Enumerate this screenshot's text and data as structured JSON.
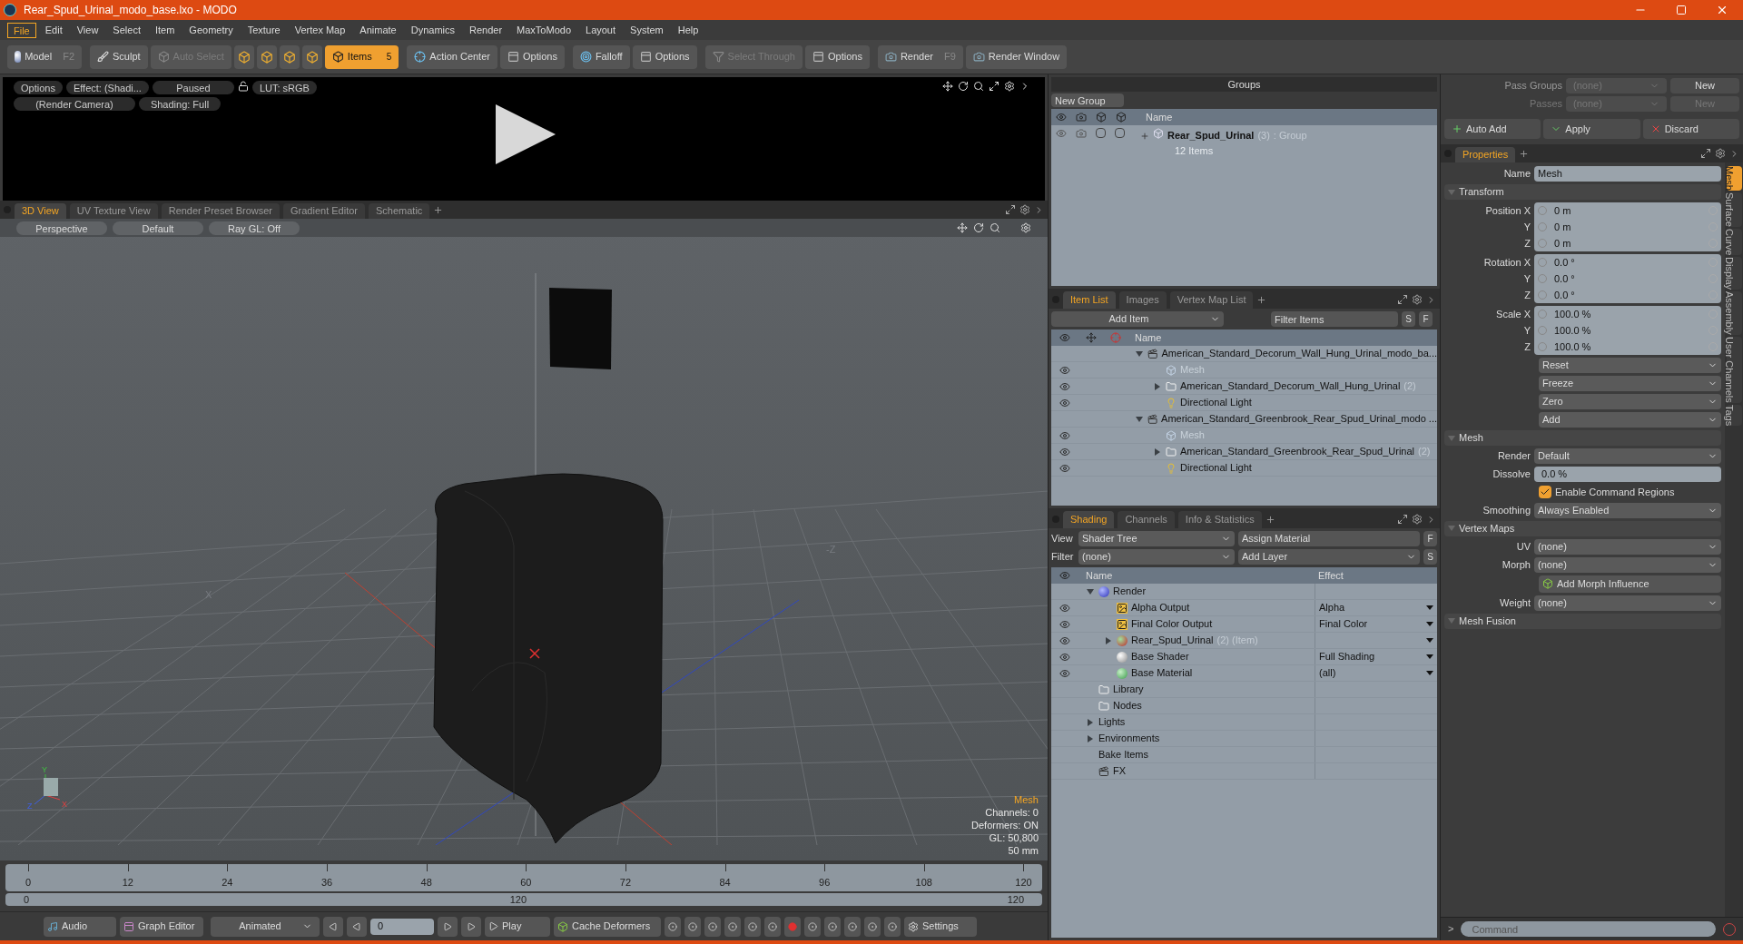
{
  "window": {
    "title": "Rear_Spud_Urinal_modo_base.lxo - MODO"
  },
  "menu": [
    {
      "label": "File",
      "selected": true
    },
    {
      "label": "Edit",
      "selected": false
    },
    {
      "label": "View",
      "selected": false
    },
    {
      "label": "Select",
      "selected": false
    },
    {
      "label": "Item",
      "selected": false
    },
    {
      "label": "Geometry",
      "selected": false
    },
    {
      "label": "Texture",
      "selected": false
    },
    {
      "label": "Vertex Map",
      "selected": false
    },
    {
      "label": "Animate",
      "selected": false
    },
    {
      "label": "Dynamics",
      "selected": false
    },
    {
      "label": "Render",
      "selected": false
    },
    {
      "label": "MaxToModo",
      "selected": false
    },
    {
      "label": "Layout",
      "selected": false
    },
    {
      "label": "System",
      "selected": false
    },
    {
      "label": "Help",
      "selected": false
    }
  ],
  "toolbar": [
    {
      "label": "Model",
      "shortcut": "F2",
      "selected": false,
      "disabled": false
    },
    {
      "label": "Sculpt",
      "selected": false,
      "disabled": false
    },
    {
      "label": "Auto Select",
      "selected": false,
      "disabled": true
    },
    {
      "label": "Items",
      "badge": "5",
      "selected": true,
      "disabled": false
    },
    {
      "label": "Action Center",
      "selected": false,
      "disabled": false
    },
    {
      "label": "Options",
      "selected": false,
      "disabled": false
    },
    {
      "label": "Falloff",
      "selected": false,
      "disabled": false
    },
    {
      "label": "Options",
      "selected": false,
      "disabled": false
    },
    {
      "label": "Select Through",
      "selected": false,
      "disabled": true
    },
    {
      "label": "Options",
      "selected": false,
      "disabled": false
    },
    {
      "label": "Render",
      "shortcut": "F9",
      "selected": false,
      "disabled": false
    },
    {
      "label": "Render Window",
      "selected": false,
      "disabled": false
    }
  ],
  "preview": {
    "row1": [
      "Options",
      "Effect: (Shadi...",
      "Paused",
      "LUT: sRGB"
    ],
    "row2": [
      "(Render Camera)",
      "Shading: Full"
    ]
  },
  "viewport_tabs": [
    {
      "label": "3D View",
      "selected": true
    },
    {
      "label": "UV Texture View",
      "selected": false
    },
    {
      "label": "Render Preset Browser",
      "selected": false
    },
    {
      "label": "Gradient Editor",
      "selected": false
    },
    {
      "label": "Schematic",
      "selected": false
    }
  ],
  "viewport": {
    "buttons": [
      "Perspective",
      "Default",
      "Ray GL: Off"
    ],
    "axis_labels": [
      "-Z",
      "X"
    ],
    "gizmo_labels": [
      "Y",
      "Z",
      "X"
    ],
    "info_title": "Mesh",
    "info": [
      "Channels: 0",
      "Deformers: ON",
      "GL: 50,800",
      "50 mm"
    ]
  },
  "timeline": {
    "ticks": [
      "0",
      "12",
      "24",
      "36",
      "48",
      "60",
      "72",
      "84",
      "96",
      "108",
      "120"
    ],
    "range_start": "0",
    "range_mid": "120",
    "range_end": "120"
  },
  "transport": {
    "audio": "Audio",
    "graph_editor": "Graph Editor",
    "mode": "Animated",
    "frame": "0",
    "play": "Play",
    "cache": "Cache Deformers",
    "settings": "Settings"
  },
  "groups": {
    "title": "Groups",
    "new_group": "New Group",
    "column": "Name",
    "rows": [
      {
        "name": "Rear_Spud_Urinal",
        "count": "(3)",
        "type": ": Group",
        "items": "12 Items",
        "flags": [
          {
            "checked": false
          },
          {
            "checked": false
          }
        ]
      }
    ]
  },
  "item_list": {
    "tabs": [
      {
        "label": "Item List",
        "selected": true
      },
      {
        "label": "Images",
        "selected": false
      },
      {
        "label": "Vertex Map List",
        "selected": false
      }
    ],
    "add_item": "Add Item",
    "filter_placeholder": "Filter Items",
    "s": "S",
    "f": "F",
    "column": "Name",
    "items": [
      {
        "name": "American_Standard_Decorum_Wall_Hung_Urinal_modo_ba...",
        "kind": "scene",
        "expanded": true,
        "visible": false,
        "children": [
          {
            "name": "Mesh",
            "kind": "mesh",
            "visible": true
          },
          {
            "name": "American_Standard_Decorum_Wall_Hung_Urinal",
            "count": "(2)",
            "kind": "group",
            "expanded": false,
            "visible": true
          },
          {
            "name": "Directional Light",
            "kind": "light",
            "visible": true
          }
        ]
      },
      {
        "name": "American_Standard_Greenbrook_Rear_Spud_Urinal_modo ...",
        "kind": "scene",
        "expanded": true,
        "visible": false,
        "children": [
          {
            "name": "Mesh",
            "kind": "mesh",
            "visible": true
          },
          {
            "name": "American_Standard_Greenbrook_Rear_Spud_Urinal",
            "count": "(2)",
            "kind": "group",
            "expanded": false,
            "visible": true
          },
          {
            "name": "Directional Light",
            "kind": "light",
            "visible": true
          }
        ]
      }
    ]
  },
  "shading": {
    "tabs": [
      {
        "label": "Shading",
        "selected": true
      },
      {
        "label": "Channels",
        "selected": false
      },
      {
        "label": "Info & Statistics",
        "selected": false
      }
    ],
    "view_label": "View",
    "view": "Shader Tree",
    "assign": "Assign Material",
    "f": "F",
    "filter_label": "Filter",
    "filter": "(none)",
    "add_layer": "Add Layer",
    "s": "S",
    "columns": [
      "Name",
      "Effect"
    ],
    "items": [
      {
        "name": "Render",
        "kind": "render",
        "expanded": true,
        "visible": false,
        "children": [
          {
            "name": "Alpha Output",
            "kind": "output",
            "effect": "Alpha",
            "visible": true
          },
          {
            "name": "Final Color Output",
            "kind": "output",
            "effect": "Final Color",
            "visible": true
          },
          {
            "name": "Rear_Spud_Urinal",
            "count": "(2) (Item)",
            "kind": "mask",
            "expanded": false,
            "visible": true
          },
          {
            "name": "Base Shader",
            "kind": "shader",
            "effect": "Full Shading",
            "visible": true
          },
          {
            "name": "Base Material",
            "kind": "material",
            "effect": "(all)",
            "visible": true
          }
        ]
      },
      {
        "name": "Library",
        "kind": "folder",
        "visible": false
      },
      {
        "name": "Nodes",
        "kind": "folder",
        "visible": false
      },
      {
        "name": "Lights",
        "kind": "plain",
        "expanded": false,
        "visible": false
      },
      {
        "name": "Environments",
        "kind": "plain",
        "expanded": false,
        "visible": false
      },
      {
        "name": "Bake Items",
        "kind": "plain",
        "visible": false
      },
      {
        "name": "FX",
        "kind": "fx",
        "visible": false
      }
    ]
  },
  "passes": [
    {
      "label": "Pass Groups",
      "value": "(none)",
      "button": "New",
      "disabled": false
    },
    {
      "label": "Passes",
      "value": "(none)",
      "button": "New",
      "disabled": true
    }
  ],
  "actions": [
    "Auto Add",
    "Apply",
    "Discard"
  ],
  "properties": {
    "tab": {
      "label": "Properties",
      "selected": true
    },
    "name_label": "Name",
    "name_value": "Mesh",
    "sections": [
      {
        "title": "Transform",
        "expanded": true,
        "rows": [
          {
            "kind": "vector",
            "labels": [
              "Position X",
              "Y",
              "Z"
            ],
            "values": [
              "0 m",
              "0 m",
              "0 m"
            ]
          },
          {
            "kind": "vector",
            "labels": [
              "Rotation X",
              "Y",
              "Z"
            ],
            "values": [
              "0.0 °",
              "0.0 °",
              "0.0 °"
            ]
          },
          {
            "kind": "vector",
            "labels": [
              "Scale X",
              "Y",
              "Z"
            ],
            "values": [
              "100.0 %",
              "100.0 %",
              "100.0 %"
            ]
          },
          {
            "kind": "menu",
            "value": "Reset"
          },
          {
            "kind": "menu",
            "value": "Freeze"
          },
          {
            "kind": "menu",
            "value": "Zero"
          },
          {
            "kind": "menu",
            "value": "Add"
          }
        ]
      },
      {
        "title": "Mesh",
        "expanded": true,
        "rows": [
          {
            "kind": "dropdown",
            "label": "Render",
            "value": "Default"
          },
          {
            "kind": "field",
            "label": "Dissolve",
            "value": "0.0 %"
          },
          {
            "kind": "checkbox",
            "label": "Enable Command Regions",
            "checked": true
          },
          {
            "kind": "dropdown",
            "label": "Smoothing",
            "value": "Always Enabled"
          }
        ]
      },
      {
        "title": "Vertex Maps",
        "expanded": true,
        "rows": [
          {
            "kind": "dropdown",
            "label": "UV",
            "value": "(none)"
          },
          {
            "kind": "dropdown",
            "label": "Morph",
            "value": "(none)"
          },
          {
            "kind": "button",
            "label": "Add Morph Influence"
          },
          {
            "kind": "dropdown",
            "label": "Weight",
            "value": "(none)"
          }
        ]
      },
      {
        "title": "Mesh Fusion",
        "expanded": true
      }
    ],
    "side_tabs": [
      {
        "label": "Mesh",
        "selected": true
      },
      {
        "label": "Surface",
        "selected": false
      },
      {
        "label": "Curve",
        "selected": false
      },
      {
        "label": "Display",
        "selected": false
      },
      {
        "label": "Assembly",
        "selected": false
      },
      {
        "label": "User Channels",
        "selected": false
      },
      {
        "label": "Tags",
        "selected": false
      }
    ]
  },
  "command": {
    "prompt": ">",
    "placeholder": "Command"
  }
}
